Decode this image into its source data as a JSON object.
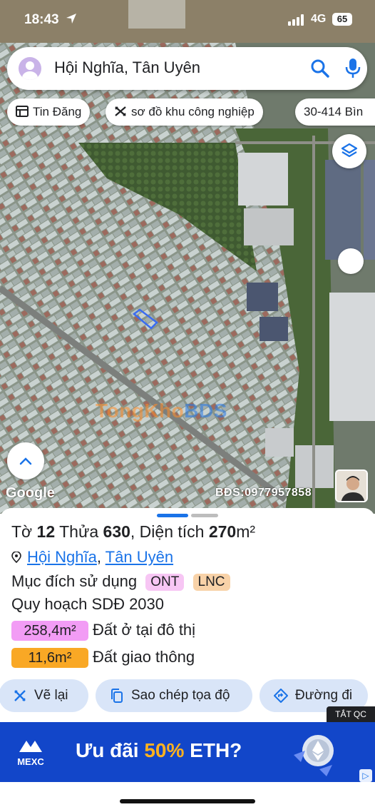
{
  "status_bar": {
    "time": "18:43",
    "network": "4G",
    "battery": "65"
  },
  "search": {
    "query": "Hội Nghĩa, Tân Uyên"
  },
  "chips": [
    {
      "label": "Tin Đăng",
      "icon": "list-icon"
    },
    {
      "label": "sơ đồ khu công nghiệp",
      "icon": "ruler-icon"
    },
    {
      "label": "30-414 Bìn"
    }
  ],
  "map": {
    "google_logo": "Google",
    "watermark_left": "TongKho",
    "watermark_right": "BDS",
    "phone_tag": "BĐS:0977957858"
  },
  "parcel": {
    "sheet_prefix": "Tờ",
    "sheet_no": "12",
    "lot_prefix": "Thửa",
    "lot_no": "630",
    "area_prefix": ", Diện tích",
    "area_value": "270",
    "area_unit": "m²",
    "ward": "Hội Nghĩa",
    "district": "Tân Uyên",
    "purpose_label": "Mục đích sử dụng",
    "purpose_tags": [
      {
        "code": "ONT",
        "color": "#f7c6f4"
      },
      {
        "code": "LNC",
        "color": "#f8d2a8"
      }
    ],
    "plan_label": "Quy hoạch SDĐ 2030",
    "plan_items": [
      {
        "area": "258,4m²",
        "label": "Đất ở tại đô thị",
        "color": "#f29cf5"
      },
      {
        "area": "11,6m²",
        "label": "Đất giao thông",
        "color": "#f9a825"
      }
    ]
  },
  "actions": {
    "redraw": "Vẽ lại",
    "copy_coords": "Sao chép tọa độ",
    "directions": "Đường đi"
  },
  "ad": {
    "close_label": "TẮT QC",
    "brand": "MEXC",
    "copy_pre": "Ưu đãi ",
    "copy_pct": "50%",
    "copy_post": " ETH?",
    "info": "▷"
  }
}
